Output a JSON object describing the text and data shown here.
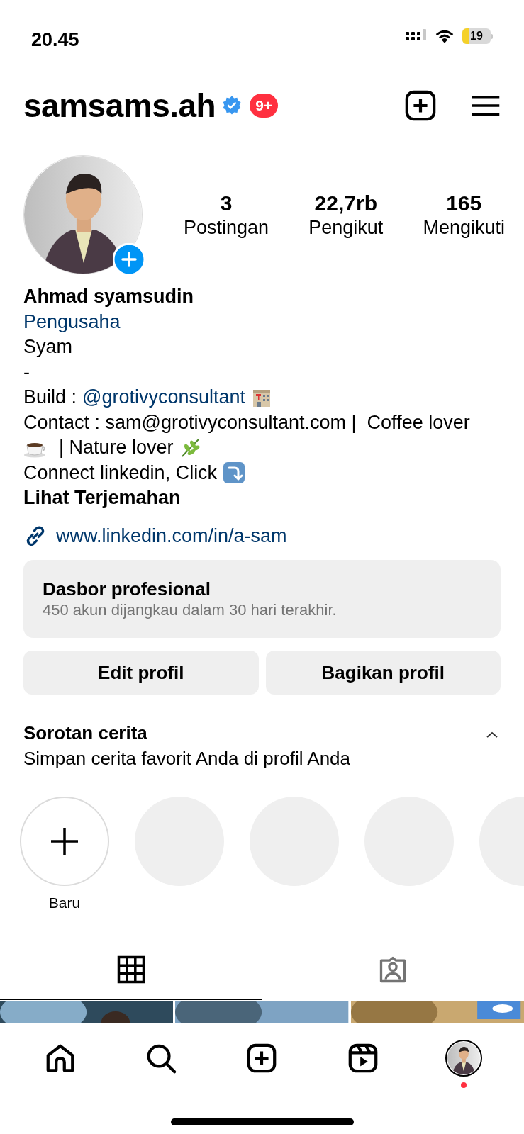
{
  "status_bar": {
    "time": "20.45",
    "battery": "19"
  },
  "header": {
    "username": "samsams.ah",
    "verified": true,
    "notification_badge": "9+"
  },
  "stats": [
    {
      "value": "3",
      "label": "Postingan"
    },
    {
      "value": "22,7rb",
      "label": "Pengikut"
    },
    {
      "value": "165",
      "label": "Mengikuti"
    }
  ],
  "name": "Ahmad syamsudin",
  "category": "Pengusaha",
  "bio": [
    [
      {
        "kind": "text",
        "text": "Syam"
      }
    ],
    [
      {
        "kind": "text",
        "text": "-"
      }
    ],
    [
      {
        "kind": "text",
        "text": "Build :"
      },
      {
        "kind": "mention",
        "text": "@grotivyconsultant"
      },
      {
        "kind": "emoji"
      }
    ],
    [
      {
        "kind": "text",
        "text": "Contact : sam@grotivyconsultant.com |  Coffee lover"
      }
    ],
    [
      {
        "kind": "emoji"
      },
      {
        "kind": "text",
        "text": "| Nature lover"
      },
      {
        "kind": "emoji"
      }
    ],
    [
      {
        "kind": "text",
        "text": "Connect linkedin, Click"
      },
      {
        "kind": "emoji"
      }
    ]
  ],
  "translate": "Lihat Terjemahan",
  "link": "www.linkedin.com/in/a-sam",
  "dashboard": {
    "title": "Dasbor profesional",
    "subtitle": "450 akun dijangkau dalam 30 hari terakhir."
  },
  "buttons": [
    "Edit profil",
    "Bagikan profil"
  ],
  "highlights": {
    "title": "Sorotan cerita",
    "subtitle": "Simpan cerita favorit Anda di profil Anda",
    "expanded": true,
    "new_label": "Baru"
  },
  "tabs": [
    {
      "kind": "grid",
      "selected": true
    },
    {
      "kind": "tagged",
      "selected": false
    }
  ],
  "posts": [
    {
      "kind": "picture"
    },
    {
      "kind": "picture"
    },
    {
      "kind": "picture"
    }
  ],
  "nav": [
    {
      "kind": "home",
      "selected": false
    },
    {
      "kind": "search",
      "selected": false
    },
    {
      "kind": "create",
      "selected": false
    },
    {
      "kind": "reels",
      "selected": false
    },
    {
      "kind": "profile",
      "selected": true,
      "has_notification": true
    }
  ]
}
